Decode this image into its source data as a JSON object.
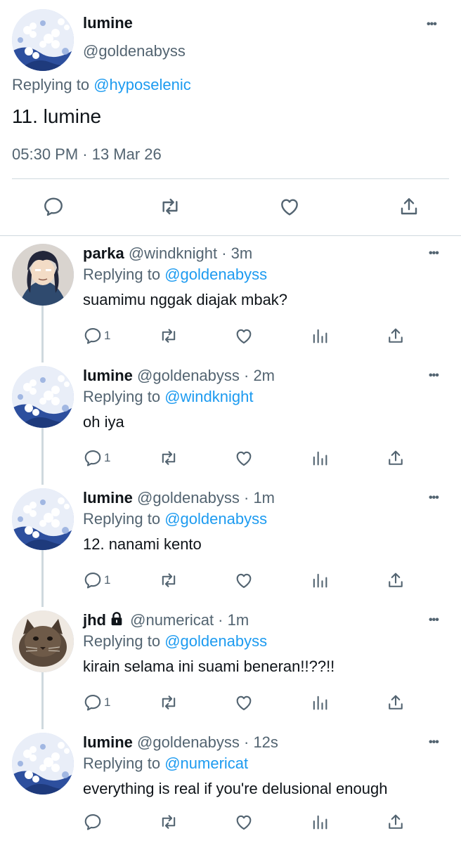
{
  "main_tweet": {
    "display_name": "lumine",
    "handle": "@goldenabyss",
    "replying_prefix": "Replying to",
    "replying_to": "@hyposelenic",
    "text": "11. lumine",
    "timestamp": "05:30 PM · 13 Mar 26",
    "more_glyph": "•••"
  },
  "replies": [
    {
      "display_name": "parka",
      "meta": "@windknight · 3m",
      "replying_prefix": "Replying to",
      "replying_to": "@goldenabyss",
      "text": "suamimu nggak diajak mbak?",
      "reply_count": "1",
      "avatar": "anime-character-avatar",
      "locked": false
    },
    {
      "display_name": "lumine",
      "meta": "@goldenabyss · 2m",
      "replying_prefix": "Replying to",
      "replying_to": "@windknight",
      "text": "oh iya",
      "reply_count": "1",
      "avatar": "blue-flowers-avatar",
      "locked": false
    },
    {
      "display_name": "lumine",
      "meta": "@goldenabyss · 1m",
      "replying_prefix": "Replying to",
      "replying_to": "@goldenabyss",
      "text": "12. nanami kento",
      "reply_count": "1",
      "avatar": "blue-flowers-avatar",
      "locked": false
    },
    {
      "display_name": "jhd",
      "meta": "@numericat · 1m",
      "replying_prefix": "Replying to",
      "replying_to": "@goldenabyss",
      "text": "kirain selama ini suami beneran!!??!!",
      "reply_count": "1",
      "avatar": "cat-avatar",
      "locked": true
    },
    {
      "display_name": "lumine",
      "meta": "@goldenabyss · 12s",
      "replying_prefix": "Replying to",
      "replying_to": "@numericat",
      "text": "everything is real if you're delusional enough",
      "reply_count": "",
      "avatar": "blue-flowers-avatar",
      "locked": false
    }
  ],
  "colors": {
    "link": "#1d9bf0",
    "secondary_text": "#536471",
    "divider": "#cfd9de"
  }
}
